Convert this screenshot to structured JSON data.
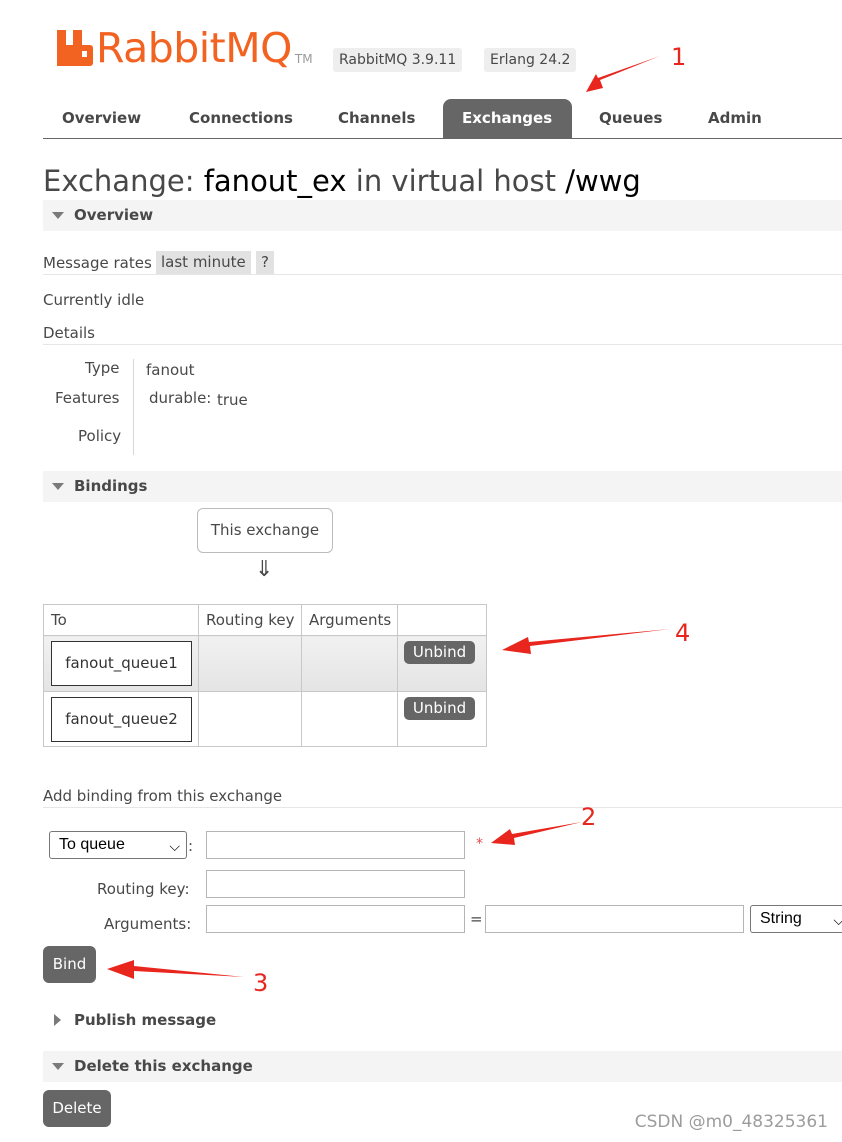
{
  "brand": {
    "name": "RabbitMQ",
    "tm": "TM",
    "color": "#f26322"
  },
  "versions": {
    "rabbitmq": "RabbitMQ 3.9.11",
    "erlang": "Erlang 24.2"
  },
  "tabs": [
    {
      "label": "Overview",
      "active": false
    },
    {
      "label": "Connections",
      "active": false
    },
    {
      "label": "Channels",
      "active": false
    },
    {
      "label": "Exchanges",
      "active": true
    },
    {
      "label": "Queues",
      "active": false
    },
    {
      "label": "Admin",
      "active": false
    }
  ],
  "title": {
    "prefix": "Exchange:",
    "name": "fanout_ex",
    "middle": "in virtual host",
    "vhost": "/wwg"
  },
  "overview": {
    "header": "Overview",
    "message_rates_label": "Message rates",
    "rate_period": "last minute",
    "help": "?",
    "idle": "Currently idle",
    "details_label": "Details",
    "type_label": "Type",
    "type_value": "fanout",
    "features_label": "Features",
    "durable_label": "durable:",
    "durable_value": "true",
    "policy_label": "Policy"
  },
  "bindings": {
    "header": "Bindings",
    "source": "This exchange",
    "arrow": "⇓",
    "columns": [
      "To",
      "Routing key",
      "Arguments"
    ],
    "rows": [
      {
        "to": "fanout_queue1",
        "routing_key": "",
        "arguments": "",
        "action": "Unbind"
      },
      {
        "to": "fanout_queue2",
        "routing_key": "",
        "arguments": "",
        "action": "Unbind"
      }
    ]
  },
  "add_binding": {
    "header": "Add binding from this exchange",
    "destination_type": "To queue",
    "colon": ":",
    "required_mark": "*",
    "routing_key_label": "Routing key:",
    "arguments_label": "Arguments:",
    "equals": "=",
    "arg_type": "String",
    "bind_button": "Bind"
  },
  "publish": {
    "header": "Publish message"
  },
  "delete": {
    "header": "Delete this exchange",
    "button": "Delete"
  },
  "annotations": [
    "1",
    "4",
    "2",
    "3"
  ],
  "annotation_color": "#e8261e",
  "watermark": "CSDN @m0_48325361"
}
